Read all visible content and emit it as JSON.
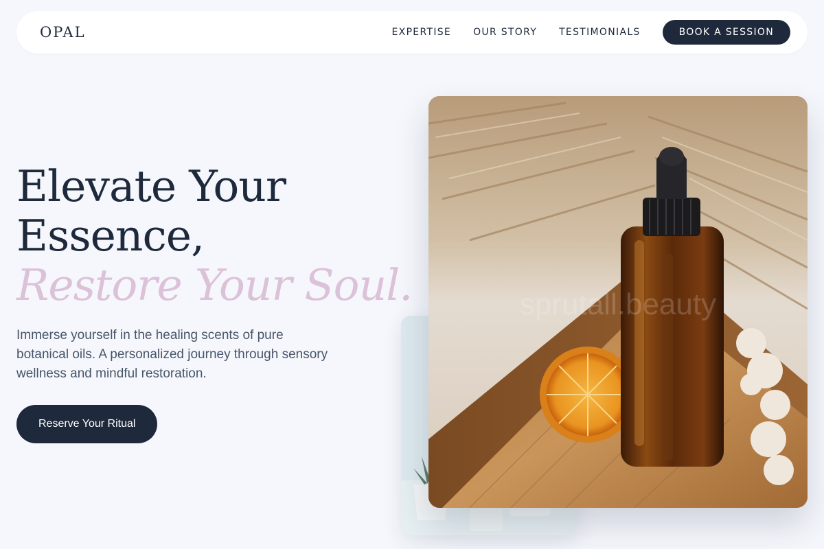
{
  "nav": {
    "logo": "OPAL",
    "links": [
      "EXPERTISE",
      "OUR STORY",
      "TESTIMONIALS"
    ],
    "cta": "BOOK A SESSION"
  },
  "hero": {
    "headline_line1": "Elevate Your",
    "headline_line2": "Essence,",
    "headline_accent": "Restore Your Soul.",
    "subtext": "Immerse yourself in the healing scents of pure botanical oils. A personalized journey through sensory wellness and mindful restoration.",
    "cta": "Reserve Your Ritual"
  },
  "images": {
    "main_alt": "Amber dropper bottle with dried orange slice and moss on a wooden tray",
    "main_watermark": "sprutall.beauty",
    "back_alt": "Small potted succulent on a pale blue background"
  },
  "colors": {
    "background": "#f5f7fc",
    "primary": "#1e293b",
    "accent": "#dcc2d9",
    "body_text": "#475569"
  }
}
